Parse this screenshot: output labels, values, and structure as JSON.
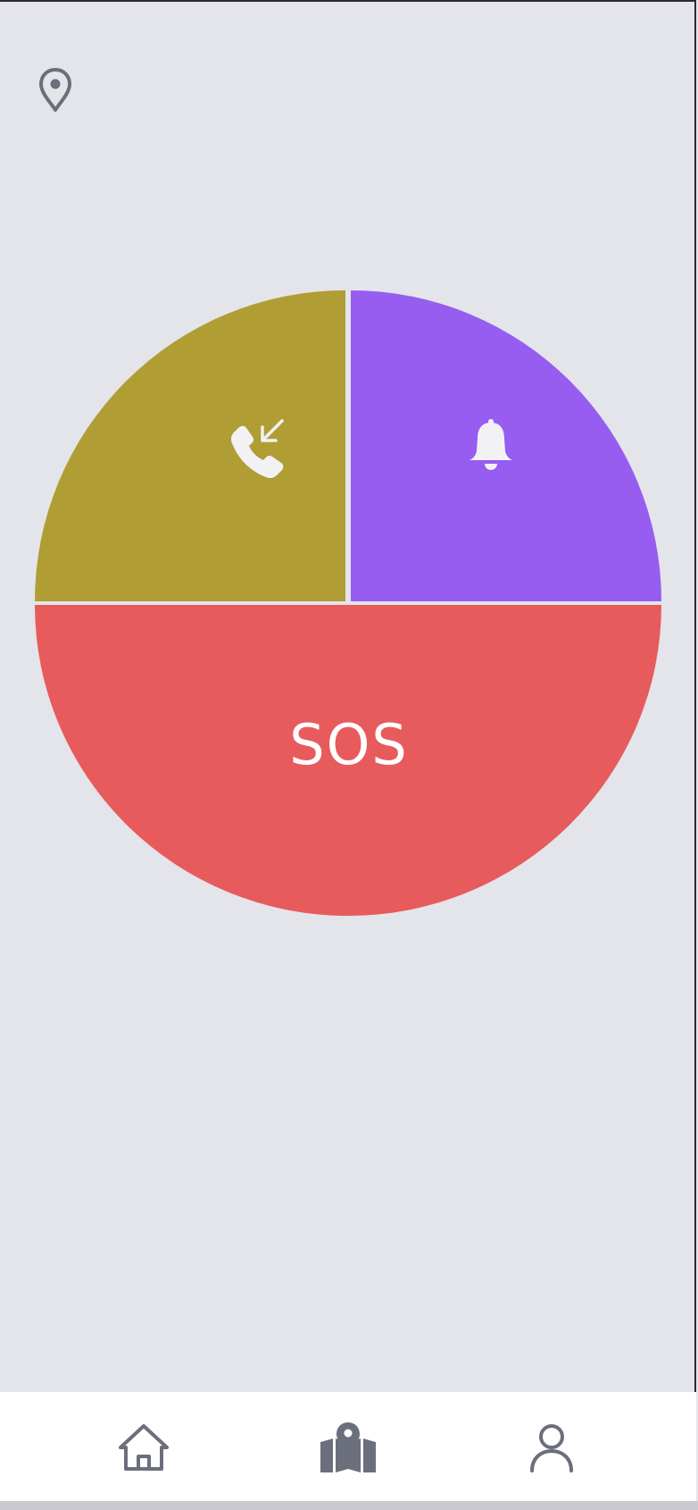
{
  "header": {
    "location_icon": "map-pin-icon"
  },
  "wheel": {
    "segments": [
      {
        "id": "incoming-call",
        "icon": "incoming-call-icon",
        "color": "#b09e35"
      },
      {
        "id": "alarm",
        "icon": "bell-icon",
        "color": "#975df0"
      },
      {
        "id": "sos",
        "label": "SOS",
        "color": "#e75b5d"
      }
    ]
  },
  "bottom_nav": {
    "items": [
      {
        "id": "home",
        "icon": "home-icon"
      },
      {
        "id": "map",
        "icon": "map-icon"
      },
      {
        "id": "profile",
        "icon": "user-icon"
      }
    ],
    "icon_color": "#6b6f7b"
  }
}
